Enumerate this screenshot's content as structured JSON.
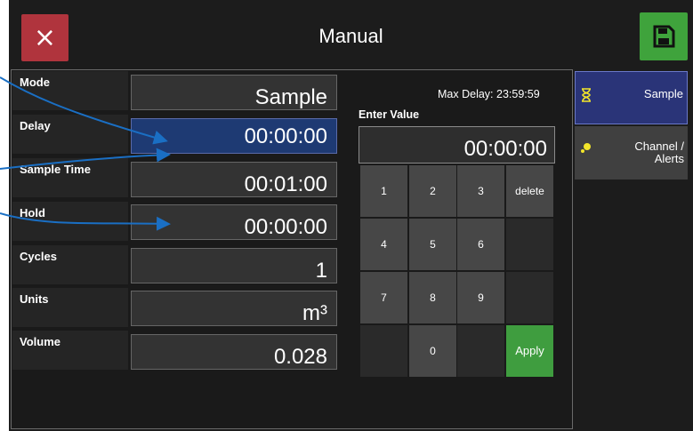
{
  "header": {
    "title": "Manual",
    "close_icon": "×"
  },
  "form": {
    "rows": [
      {
        "label": "Mode",
        "value": "Sample"
      },
      {
        "label": "Delay",
        "value": "00:00:00"
      },
      {
        "label": "Sample Time",
        "value": "00:01:00"
      },
      {
        "label": "Hold",
        "value": "00:00:00"
      },
      {
        "label": "Cycles",
        "value": "1"
      },
      {
        "label": "Units",
        "value": "m³"
      },
      {
        "label": "Volume",
        "value": "0.028"
      }
    ]
  },
  "keypad": {
    "max_delay": "Max Delay: 23:59:59",
    "enter_label": "Enter Value",
    "display_value": "00:00:00",
    "keys": [
      "1",
      "2",
      "3",
      "delete",
      "4",
      "5",
      "6",
      "",
      "7",
      "8",
      "9",
      "",
      "",
      "0",
      "",
      "Apply"
    ]
  },
  "side_tabs": [
    {
      "label": "Sample",
      "icon": "hourglass-icon"
    },
    {
      "label_line1": "Channel /",
      "label_line2": "Alerts",
      "icon": "channel-alerts-icon"
    }
  ],
  "colors": {
    "close": "#b0343d",
    "save": "#3fa33c",
    "active_field": "#1e3a73",
    "selected_tab": "#2a3478",
    "apply": "#3f9d3f",
    "annotation_arrow": "#1a6fc4",
    "icon_yellow": "#f2e52a"
  }
}
